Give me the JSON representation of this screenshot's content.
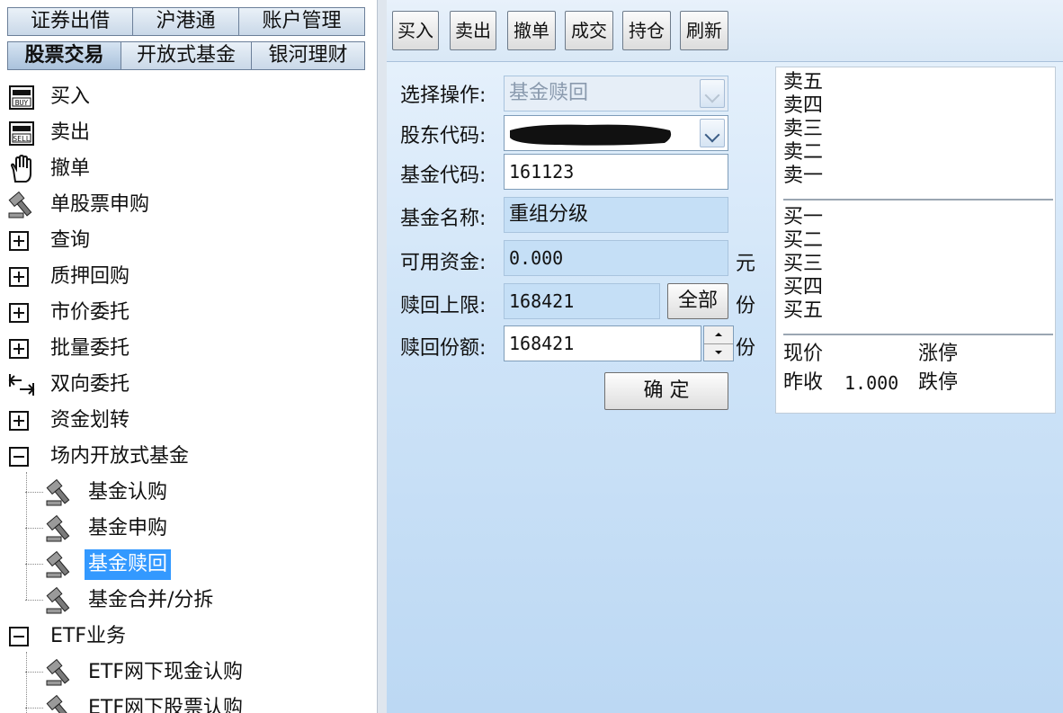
{
  "tabs_row1": [
    "证券出借",
    "沪港通",
    "账户管理"
  ],
  "tabs_row2": [
    "股票交易",
    "开放式基金",
    "银河理财"
  ],
  "tree": {
    "buy": "买入",
    "sell": "卖出",
    "cancel": "撤单",
    "single_ipo": "单股票申购",
    "query": "查询",
    "pledge_repo": "质押回购",
    "market_order": "市价委托",
    "batch_order": "批量委托",
    "two_way_order": "双向委托",
    "fund_transfer": "资金划转",
    "otc_fund": "场内开放式基金",
    "fund_subscribe": "基金认购",
    "fund_purchase": "基金申购",
    "fund_redeem": "基金赎回",
    "fund_merge_split": "基金合并/分拆",
    "etf": "ETF业务",
    "etf_cash_sub": "ETF网下现金认购",
    "etf_stock_sub": "ETF网下股票认购"
  },
  "toolbar": [
    "买入",
    "卖出",
    "撤单",
    "成交",
    "持仓",
    "刷新"
  ],
  "form": {
    "operation_label": "选择操作:",
    "operation_value": "基金赎回",
    "holder_label": "股东代码:",
    "fund_code_label": "基金代码:",
    "fund_code_value": "161123",
    "fund_name_label": "基金名称:",
    "fund_name_value": "重组分级",
    "available_label": "可用资金:",
    "available_value": "0.000",
    "available_unit": "元",
    "limit_label": "赎回上限:",
    "limit_value": "168421",
    "all_button": "全部",
    "limit_unit": "份",
    "amount_label": "赎回份额:",
    "amount_value": "168421",
    "amount_unit": "份",
    "confirm_button": "确 定"
  },
  "quote": {
    "sell_levels": [
      "卖五",
      "卖四",
      "卖三",
      "卖二",
      "卖一"
    ],
    "buy_levels": [
      "买一",
      "买二",
      "买三",
      "买四",
      "买五"
    ],
    "current_price_label": "现价",
    "limit_up_label": "涨停",
    "prev_close_label": "昨收",
    "prev_close_value": "1.000",
    "limit_down_label": "跌停"
  }
}
